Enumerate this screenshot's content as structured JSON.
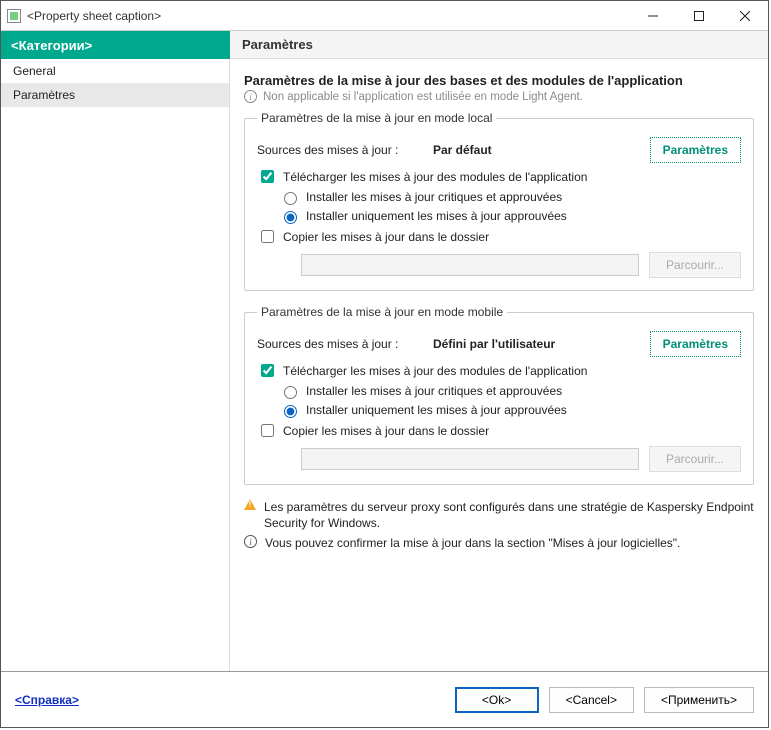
{
  "window": {
    "title": "<Property sheet caption>"
  },
  "header": {
    "categories": "<Категории>",
    "page": "Paramètres"
  },
  "sidebar": {
    "items": [
      {
        "label": "General"
      },
      {
        "label": "Paramètres"
      }
    ]
  },
  "section": {
    "title": "Paramètres de la mise à jour des bases et des modules de l'application",
    "note": "Non applicable si l'application est utilisée en mode Light Agent."
  },
  "local": {
    "legend": "Paramètres de la mise à jour en mode local",
    "sources_label": "Sources des mises à jour :",
    "sources_value": "Par défaut",
    "settings_btn": "Paramètres",
    "download_modules": "Télécharger les mises à jour des modules de l'application",
    "radio_crit": "Installer les mises à jour critiques et approuvées",
    "radio_appr": "Installer uniquement les mises à jour approuvées",
    "copy_folder": "Copier les mises à jour dans le dossier",
    "browse": "Parcourir..."
  },
  "mobile": {
    "legend": "Paramètres de la mise à jour en mode mobile",
    "sources_label": "Sources des mises à jour :",
    "sources_value": "Défini par l'utilisateur",
    "settings_btn": "Paramètres",
    "download_modules": "Télécharger les mises à jour des modules de l'application",
    "radio_crit": "Installer les mises à jour critiques et approuvées",
    "radio_appr": "Installer uniquement les mises à jour approuvées",
    "copy_folder": "Copier les mises à jour dans le dossier",
    "browse": "Parcourir..."
  },
  "notes": {
    "warn": "Les paramètres du serveur proxy sont configurés dans une stratégie de Kaspersky Endpoint Security for Windows.",
    "info": "Vous pouvez confirmer la mise à jour dans la section \"Mises à jour logicielles\"."
  },
  "footer": {
    "help": "<Справка>",
    "ok": "<Ok>",
    "cancel": "<Cancel>",
    "apply": "<Применить>"
  }
}
